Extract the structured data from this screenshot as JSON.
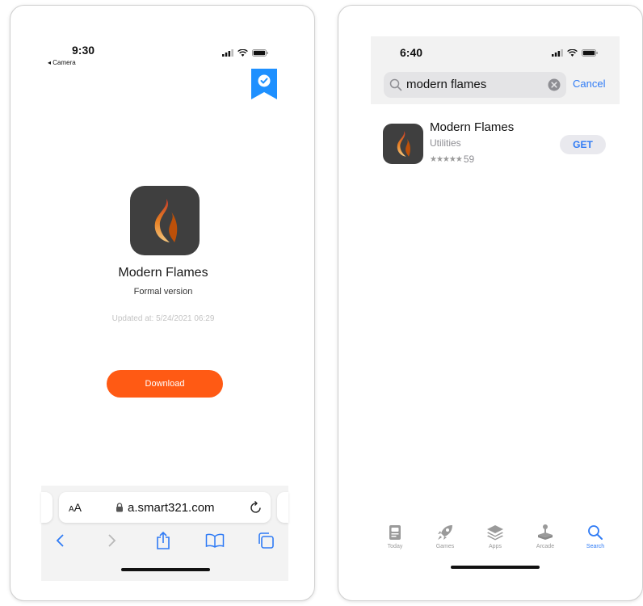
{
  "left_phone": {
    "status": {
      "time": "9:30",
      "back_label": "◂ Camera"
    },
    "app": {
      "name": "Modern Flames",
      "version": "Formal version",
      "updated": "Updated at: 5/24/2021 06:29"
    },
    "download_label": "Download",
    "browser": {
      "text_size_label_small": "A",
      "text_size_label_big": "A",
      "url": "a.smart321.com"
    },
    "colors": {
      "accent": "#ff5a14",
      "badge": "#1e90ff"
    }
  },
  "right_phone": {
    "status": {
      "time": "6:40"
    },
    "search": {
      "query": "modern flames",
      "cancel_label": "Cancel"
    },
    "result": {
      "name": "Modern Flames",
      "category": "Utilities",
      "stars": "★★★★★",
      "rating_count": "59",
      "get_label": "GET"
    },
    "tabs": [
      {
        "label": "Today",
        "icon": "today-icon"
      },
      {
        "label": "Games",
        "icon": "rocket-icon"
      },
      {
        "label": "Apps",
        "icon": "layers-icon"
      },
      {
        "label": "Arcade",
        "icon": "joystick-icon"
      },
      {
        "label": "Search",
        "icon": "search-icon",
        "active": true
      }
    ],
    "colors": {
      "link": "#2f7bf5"
    }
  }
}
